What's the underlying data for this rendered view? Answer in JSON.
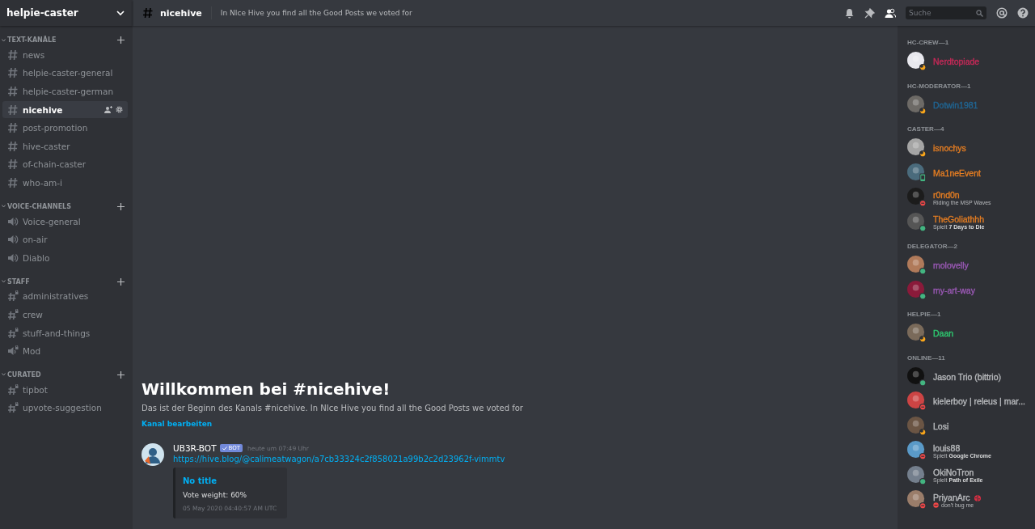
{
  "server": {
    "name": "helpie-caster"
  },
  "categories": [
    {
      "name": "TEXT-KANÄLE",
      "channels": [
        {
          "kind": "text",
          "name": "news",
          "selected": false
        },
        {
          "kind": "text",
          "name": "helpie-caster-general",
          "selected": false
        },
        {
          "kind": "text",
          "name": "helpie-caster-german",
          "selected": false
        },
        {
          "kind": "text",
          "name": "nicehive",
          "selected": true
        },
        {
          "kind": "text",
          "name": "post-promotion",
          "selected": false
        },
        {
          "kind": "text",
          "name": "hive-caster",
          "selected": false
        },
        {
          "kind": "text",
          "name": "of-chain-caster",
          "selected": false
        },
        {
          "kind": "text",
          "name": "who-am-i",
          "selected": false
        }
      ]
    },
    {
      "name": "VOICE-CHANNELS",
      "channels": [
        {
          "kind": "voice",
          "name": "Voice-general",
          "selected": false
        },
        {
          "kind": "voice",
          "name": "on-air",
          "selected": false
        },
        {
          "kind": "voice",
          "name": "Diablo",
          "selected": false
        }
      ]
    },
    {
      "name": "STAFF",
      "channels": [
        {
          "kind": "locked-text",
          "name": "administratives",
          "selected": false
        },
        {
          "kind": "locked-text",
          "name": "crew",
          "selected": false
        },
        {
          "kind": "locked-text",
          "name": "stuff-and-things",
          "selected": false
        },
        {
          "kind": "locked-voice",
          "name": "Mod",
          "selected": false
        }
      ]
    },
    {
      "name": "CURATED",
      "channels": [
        {
          "kind": "locked-text",
          "name": "tipbot",
          "selected": false
        },
        {
          "kind": "locked-text",
          "name": "upvote-suggestion",
          "selected": false
        }
      ]
    }
  ],
  "header": {
    "channel": "nicehive",
    "topic": "In NIce Hive you find all the Good Posts we voted for",
    "search": {
      "placeholder": "Suche"
    }
  },
  "welcome": {
    "title": "Willkommen bei #nicehive!",
    "text": "Das ist der Beginn des Kanals #nicehive. In NIce Hive you find all the Good Posts we voted for",
    "link": "Kanal bearbeiten"
  },
  "message": {
    "author": "UB3R-BOT",
    "badge": "BOT",
    "time": "heute um 07:49 Uhr",
    "url": "https://hive.blog/@calimeatwagon/a7cb33324c2f858021a99b2c2d23962f-vimmtv",
    "embed": {
      "title": "No title",
      "text": "Vote weight: 60%",
      "footer": "05 May 2020 04:40:57 AM UTC"
    }
  },
  "member_groups": [
    {
      "name": "HC-CREW—1",
      "members": [
        {
          "name": "Nerdtopiade",
          "color": "#c72958",
          "kind": "idle"
        }
      ]
    },
    {
      "name": "HC-MODERATOR—1",
      "members": [
        {
          "name": "Dotwin1981",
          "color": "#206694",
          "kind": "idle"
        }
      ]
    },
    {
      "name": "CASTER—4",
      "members": [
        {
          "name": "isnochys",
          "color": "#e67e22",
          "kind": "idle"
        },
        {
          "name": "Ma1neEvent",
          "color": "#e67e22",
          "kind": "mobile"
        },
        {
          "name": "r0nd0n",
          "color": "#e67e22",
          "kind": "dnd",
          "activity": "Riding the MSP Waves"
        },
        {
          "name": "TheGoliathhh",
          "color": "#e67e22",
          "kind": "online",
          "activity": "Spielt **7 Days to Die**"
        }
      ]
    },
    {
      "name": "DELEGATOR—2",
      "members": [
        {
          "name": "molovelly",
          "color": "#9b59b6",
          "kind": "online"
        },
        {
          "name": "my-art-way",
          "color": "#9b59b6",
          "kind": "online"
        }
      ]
    },
    {
      "name": "HELPIE—1",
      "members": [
        {
          "name": "Daan",
          "color": "#2ecc71",
          "kind": "idle"
        }
      ]
    },
    {
      "name": "ONLINE—11",
      "members": [
        {
          "name": "Jason Trio (bittrio)",
          "color": "#b9bbbe",
          "kind": "online"
        },
        {
          "name": "kielerboy | releus | mar...",
          "color": "#b9bbbe",
          "kind": "dnd"
        },
        {
          "name": "Losi",
          "color": "#b9bbbe",
          "kind": "idle"
        },
        {
          "name": "louis88",
          "color": "#b9bbbe",
          "kind": "dnd",
          "activity": "Spielt **Google Chrome**"
        },
        {
          "name": "OkiNoTron",
          "color": "#b9bbbe",
          "kind": "online",
          "activity": "Spielt **Path of Exile**"
        },
        {
          "name": "PriyanArc",
          "color": "#b9bbbe",
          "kind": "dnd",
          "custom_status": "don't bug me"
        }
      ]
    }
  ]
}
